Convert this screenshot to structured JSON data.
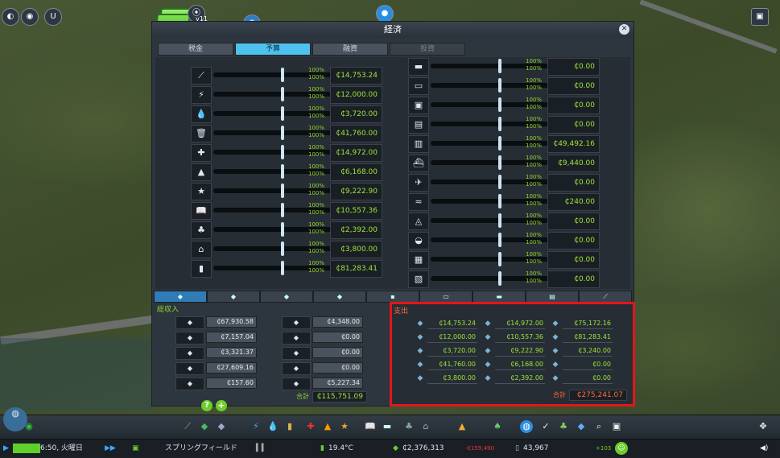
{
  "window": {
    "title": "経済",
    "close_glyph": "✕"
  },
  "top": {
    "version": "v11"
  },
  "tabs": [
    {
      "label": "税金",
      "state": "normal"
    },
    {
      "label": "予算",
      "state": "active"
    },
    {
      "label": "融資",
      "state": "normal"
    },
    {
      "label": "投資",
      "state": "disabled"
    }
  ],
  "budget_left": [
    {
      "icon": "road-icon",
      "glyph": "⟋",
      "day": "100%",
      "night": "100%",
      "value": "₵14,753.24"
    },
    {
      "icon": "electricity-icon",
      "glyph": "⚡",
      "day": "100%",
      "night": "100%",
      "value": "₵12,000.00"
    },
    {
      "icon": "water-icon",
      "glyph": "💧",
      "day": "100%",
      "night": "100%",
      "value": "₵3,720.00"
    },
    {
      "icon": "garbage-icon",
      "glyph": "🗑",
      "day": "100%",
      "night": "100%",
      "value": "₵41,760.00"
    },
    {
      "icon": "healthcare-icon",
      "glyph": "✚",
      "day": "100%",
      "night": "100%",
      "value": "₵14,972.00"
    },
    {
      "icon": "fire-icon",
      "glyph": "▲",
      "day": "100%",
      "night": "100%",
      "value": "₵6,168.00"
    },
    {
      "icon": "police-icon",
      "glyph": "★",
      "day": "100%",
      "night": "100%",
      "value": "₵9,222.90"
    },
    {
      "icon": "education-icon",
      "glyph": "📖",
      "day": "100%",
      "night": "100%",
      "value": "₵10,557.36"
    },
    {
      "icon": "park-icon",
      "glyph": "♣",
      "day": "100%",
      "night": "100%",
      "value": "₵2,392.00"
    },
    {
      "icon": "monument-icon",
      "glyph": "⌂",
      "day": "100%",
      "night": "100%",
      "value": "₵3,800.00"
    },
    {
      "icon": "industry-icon",
      "glyph": "▮",
      "day": "100%",
      "night": "100%",
      "value": "₵81,283.41"
    }
  ],
  "budget_right": [
    {
      "icon": "bus-icon",
      "glyph": "▬",
      "day": "100%",
      "night": "100%",
      "value": "₵0.00"
    },
    {
      "icon": "tram-icon",
      "glyph": "▭",
      "day": "100%",
      "night": "100%",
      "value": "₵0.00"
    },
    {
      "icon": "metro-icon",
      "glyph": "▣",
      "day": "100%",
      "night": "100%",
      "value": "₵0.00"
    },
    {
      "icon": "train-icon",
      "glyph": "▤",
      "day": "100%",
      "night": "100%",
      "value": "₵0.00"
    },
    {
      "icon": "monorail-icon",
      "glyph": "▥",
      "day": "100%",
      "night": "100%",
      "value": "₵49,492.16"
    },
    {
      "icon": "ship-icon",
      "glyph": "⛴",
      "day": "100%",
      "night": "100%",
      "value": "₵9,440.00"
    },
    {
      "icon": "plane-icon",
      "glyph": "✈",
      "day": "100%",
      "night": "100%",
      "value": "₵0.00"
    },
    {
      "icon": "ferry-icon",
      "glyph": "≈",
      "day": "100%",
      "night": "100%",
      "value": "₵240.00"
    },
    {
      "icon": "cablecar-icon",
      "glyph": "◬",
      "day": "100%",
      "night": "100%",
      "value": "₵0.00"
    },
    {
      "icon": "taxi-icon",
      "glyph": "◒",
      "day": "100%",
      "night": "100%",
      "value": "₵0.00"
    },
    {
      "icon": "post-icon",
      "glyph": "▦",
      "day": "100%",
      "night": "100%",
      "value": "₵0.00"
    },
    {
      "icon": "cargo-icon",
      "glyph": "▧",
      "day": "100%",
      "night": "100%",
      "value": "₵0.00"
    }
  ],
  "income": {
    "label": "総収入",
    "rows_left": [
      {
        "icon": "residential-icon",
        "value": "₵67,930.58"
      },
      {
        "icon": "commercial-icon",
        "value": "₵7,157.04"
      },
      {
        "icon": "industrial-icon",
        "value": "₵3,321.37"
      },
      {
        "icon": "office-icon",
        "value": "₵27,609.16"
      },
      {
        "icon": "road-tolls-icon",
        "value": "₵157.60"
      }
    ],
    "rows_right": [
      {
        "icon": "bus-income-icon",
        "value": "₵4,348.00"
      },
      {
        "icon": "tourism-income-icon",
        "value": "₵0.00"
      },
      {
        "icon": "park-income-icon",
        "value": "₵0.00"
      },
      {
        "icon": "education-income-icon",
        "value": "₵0.00"
      },
      {
        "icon": "industry-income-icon",
        "value": "₵5,227.34"
      }
    ],
    "total_label": "合計",
    "total_value": "₵115,751.09"
  },
  "expenses": {
    "label": "支出",
    "col1": [
      {
        "icon": "road-icon",
        "value": "₵14,753.24"
      },
      {
        "icon": "electricity-icon",
        "value": "₵12,000.00"
      },
      {
        "icon": "water-icon",
        "value": "₵3,720.00"
      },
      {
        "icon": "garbage-icon",
        "value": "₵41,760.00"
      },
      {
        "icon": "monument-icon",
        "value": "₵3,800.00"
      }
    ],
    "col2": [
      {
        "icon": "healthcare-icon",
        "value": "₵14,972.00"
      },
      {
        "icon": "education-icon",
        "value": "₵10,557.36"
      },
      {
        "icon": "police-icon",
        "value": "₵9,222.90"
      },
      {
        "icon": "fire-icon",
        "value": "₵6,168.00"
      },
      {
        "icon": "park-icon",
        "value": "₵2,392.00"
      }
    ],
    "col3": [
      {
        "icon": "transport-icon",
        "value": "₵75,172.16"
      },
      {
        "icon": "industry-icon",
        "value": "₵81,283.41"
      },
      {
        "icon": "policies-icon",
        "value": "₵3,240.00"
      },
      {
        "icon": "loans-icon",
        "value": "₵0.00"
      },
      {
        "icon": "misc-icon",
        "value": "₵0.00"
      }
    ],
    "total_label": "合計",
    "total_value": "₵275,241.07"
  },
  "status": {
    "time": "6:50, 火曜日",
    "city_name": "スプリングフィールド",
    "temperature": "19.4°C",
    "money": "₵2,376,313",
    "money_delta": "-₵159,490",
    "population": "43,967",
    "population_delta": "+103"
  },
  "colors": {
    "accent": "#4ec2ee",
    "value_green": "#9ee43a",
    "highlight_red": "#e3161b",
    "expense_total": "#ff6a3d"
  }
}
